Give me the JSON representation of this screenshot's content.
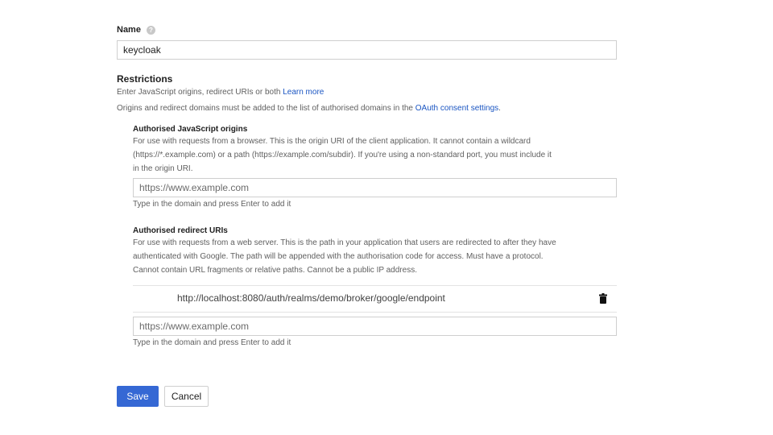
{
  "name_section": {
    "label": "Name",
    "help_icon": "help-icon",
    "value": "keycloak"
  },
  "restrictions": {
    "title": "Restrictions",
    "intro_text": "Enter JavaScript origins, redirect URIs or both",
    "learn_more": "Learn more",
    "domains_text": "Origins and redirect domains must be added to the list of authorised domains in the",
    "consent_link": "OAuth consent settings",
    "consent_suffix": "."
  },
  "js_origins": {
    "title": "Authorised JavaScript origins",
    "desc_line1": "For use with requests from a browser. This is the origin URI of the client application. It cannot contain a wildcard",
    "desc_line2": "(https://*.example.com) or a path (https://example.com/subdir). If you're using a non-standard port, you must include it",
    "desc_line3": "in the origin URI.",
    "placeholder": "https://www.example.com",
    "hint": "Type in the domain and press Enter to add it"
  },
  "redirect_uris": {
    "title": "Authorised redirect URIs",
    "desc_line1": "For use with requests from a web server. This is the path in your application that users are redirected to after they have",
    "desc_line2": "authenticated with Google. The path will be appended with the authorisation code for access. Must have a protocol.",
    "desc_line3": "Cannot contain URL fragments or relative paths. Cannot be a public IP address.",
    "entries": [
      "http://localhost:8080/auth/realms/demo/broker/google/endpoint"
    ],
    "delete_icon": "trash-icon",
    "placeholder": "https://www.example.com",
    "hint": "Type in the domain and press Enter to add it"
  },
  "actions": {
    "save_label": "Save",
    "cancel_label": "Cancel"
  },
  "colors": {
    "accent": "#3568d4",
    "link": "#1a55c2"
  }
}
